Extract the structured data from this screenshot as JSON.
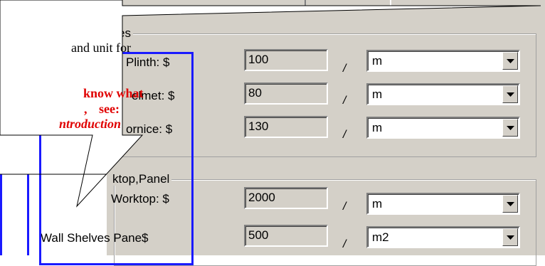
{
  "groups": {
    "profiles_title_partial": "es",
    "worktop_title": "ktop,Panel"
  },
  "rows": [
    {
      "label": "Plinth: $",
      "value": "100",
      "separator": "/",
      "unit": "m"
    },
    {
      "label": "elmet: $",
      "value": "80",
      "separator": "/",
      "unit": "m"
    },
    {
      "label": "ornice: $",
      "value": "130",
      "separator": "/",
      "unit": "m"
    },
    {
      "label": "Worktop: $",
      "value": "2000",
      "separator": "/",
      "unit": "m"
    },
    {
      "label": "Wall Shelves Pane$",
      "value": "500",
      "separator": "/",
      "unit": "m2"
    }
  ],
  "callout": {
    "line1": "and unit for",
    "line2": "know what",
    "line3a": ",",
    "line3b": "see:",
    "line4": "ntroduction"
  },
  "colors": {
    "panel": "#d4d0c8",
    "highlight": "#1a1aff",
    "callout_text": "#e00000"
  },
  "icons": {
    "dropdown": "chevron-down-icon"
  }
}
